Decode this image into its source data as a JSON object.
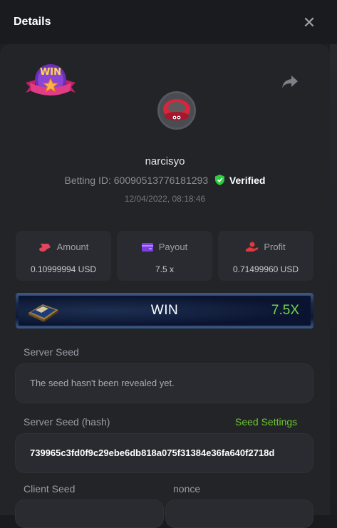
{
  "modal": {
    "title": "Details",
    "close_icon": "close-icon",
    "share_icon": "share-icon"
  },
  "user": {
    "name": "narcisyo",
    "betting_id_label": "Betting ID:",
    "betting_id": "600905137761812​93",
    "verified": "Verified",
    "date": "12/04/2022, 08:18:46"
  },
  "stats": {
    "amount": {
      "label": "Amount",
      "value": "0.10999994 USD",
      "icon": "coins-icon",
      "color": "#e0465c"
    },
    "payout": {
      "label": "Payout",
      "value": "7.5 x",
      "icon": "wallet-icon",
      "color": "#7b3fe4"
    },
    "profit": {
      "label": "Profit",
      "value": "0.71499960 USD",
      "icon": "profit-hand-icon",
      "color": "#e0393e"
    }
  },
  "result": {
    "label": "WIN",
    "multiplier": "7.5X"
  },
  "server_seed": {
    "label": "Server Seed",
    "value": "The seed hasn't been revealed yet."
  },
  "server_seed_hash": {
    "label": "Server Seed (hash)",
    "link": "Seed Settings",
    "value": "739965c3fd0f9c29ebe6db818a075f31384e36fa640f2718d"
  },
  "client_seed": {
    "label": "Client Seed"
  },
  "nonce": {
    "label": "nonce"
  },
  "colors": {
    "accent_green": "#6cc62f",
    "verified_green": "#2ecc40",
    "win_multiplier": "#73d64a"
  }
}
